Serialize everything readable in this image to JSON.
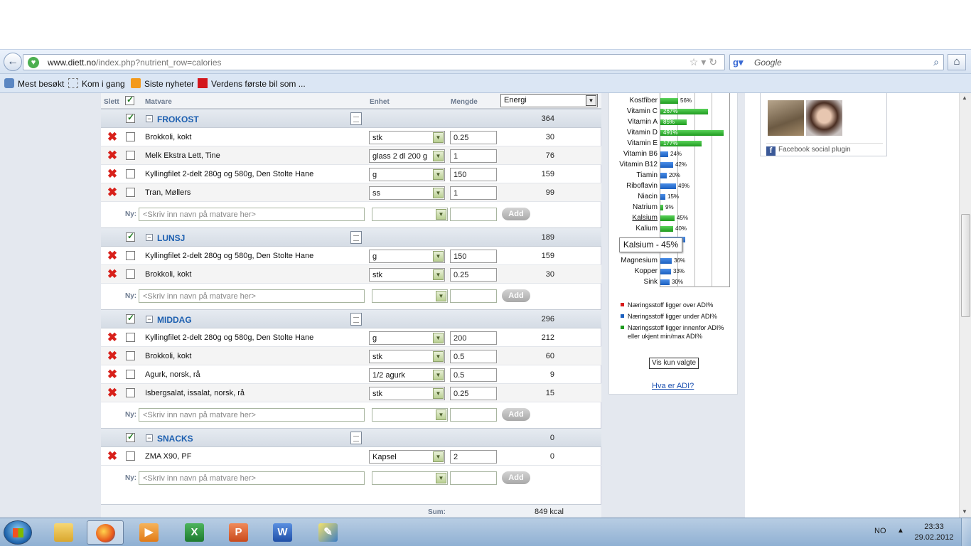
{
  "browser": {
    "url_domain": "www.diett.no",
    "url_path": "/index.php?nutrient_row=calories",
    "search_placeholder": "Google"
  },
  "bookmarks": [
    {
      "label": "Mest besøkt"
    },
    {
      "label": "Kom i gang"
    },
    {
      "label": "Siste nyheter"
    },
    {
      "label": "Verdens første bil som ..."
    }
  ],
  "columns": {
    "delete": "Slett",
    "food": "Matvare",
    "unit": "Enhet",
    "amount": "Mengde",
    "nutrient_select": "Energi"
  },
  "meals": [
    {
      "title": "FROKOST",
      "total": "364",
      "items": [
        {
          "name": "Brokkoli, kokt",
          "unit": "stk",
          "qty": "0.25",
          "value": "30"
        },
        {
          "name": "Melk Ekstra Lett, Tine",
          "unit": "glass 2 dl 200 g",
          "qty": "1",
          "value": "76"
        },
        {
          "name": "Kyllingfilet 2-delt 280g og 580g, Den Stolte Hane",
          "unit": "g",
          "qty": "150",
          "value": "159"
        },
        {
          "name": "Tran, Møllers",
          "unit": "ss",
          "qty": "1",
          "value": "99"
        }
      ]
    },
    {
      "title": "LUNSJ",
      "total": "189",
      "items": [
        {
          "name": "Kyllingfilet 2-delt 280g og 580g, Den Stolte Hane",
          "unit": "g",
          "qty": "150",
          "value": "159"
        },
        {
          "name": "Brokkoli, kokt",
          "unit": "stk",
          "qty": "0.25",
          "value": "30"
        }
      ]
    },
    {
      "title": "MIDDAG",
      "total": "296",
      "items": [
        {
          "name": "Kyllingfilet 2-delt 280g og 580g, Den Stolte Hane",
          "unit": "g",
          "qty": "200",
          "value": "212"
        },
        {
          "name": "Brokkoli, kokt",
          "unit": "stk",
          "qty": "0.5",
          "value": "60"
        },
        {
          "name": "Agurk, norsk, rå",
          "unit": "1/2 agurk",
          "qty": "0.5",
          "value": "9"
        },
        {
          "name": "Isbergsalat, issalat, norsk, rå",
          "unit": "stk",
          "qty": "0.25",
          "value": "15"
        }
      ]
    },
    {
      "title": "SNACKS",
      "total": "0",
      "items": [
        {
          "name": "ZMA X90, PF",
          "unit": "Kapsel",
          "qty": "2",
          "value": "0"
        }
      ]
    }
  ],
  "new_row": {
    "label": "Ny:",
    "placeholder": "<Skriv inn navn på matvare her>",
    "add_label": "Add"
  },
  "sum": {
    "label": "Sum:",
    "value": "849 kcal"
  },
  "nutrients": [
    {
      "name": "Kostfiber",
      "pct": 56,
      "label": "56%",
      "color": "green"
    },
    {
      "name": "Vitamin C",
      "pct": 267,
      "label": "267%",
      "color": "green"
    },
    {
      "name": "Vitamin A",
      "pct": 85,
      "label": "85%",
      "color": "green"
    },
    {
      "name": "Vitamin D",
      "pct": 491,
      "label": "491%",
      "color": "green"
    },
    {
      "name": "Vitamin E",
      "pct": 177,
      "label": "177%",
      "color": "green"
    },
    {
      "name": "Vitamin B6",
      "pct": 24,
      "label": "24%",
      "color": "blue"
    },
    {
      "name": "Vitamin B12",
      "pct": 42,
      "label": "42%",
      "color": "blue"
    },
    {
      "name": "Tiamin",
      "pct": 20,
      "label": "20%",
      "color": "blue"
    },
    {
      "name": "Riboflavin",
      "pct": 49,
      "label": "49%",
      "color": "blue"
    },
    {
      "name": "Niacin",
      "pct": 15,
      "label": "15%",
      "color": "blue"
    },
    {
      "name": "Natrium",
      "pct": 9,
      "label": "9%",
      "color": "green"
    },
    {
      "name": "Kalsium",
      "pct": 45,
      "label": "45%",
      "color": "green",
      "link": true
    },
    {
      "name": "Kalium",
      "pct": 40,
      "label": "40%",
      "color": "green"
    },
    {
      "name": "",
      "pct": 80,
      "label": "",
      "color": "blue"
    },
    {
      "name": "",
      "pct": 0,
      "label": "",
      "color": "blue"
    },
    {
      "name": "Magnesium",
      "pct": 36,
      "label": "36%",
      "color": "blue"
    },
    {
      "name": "Kopper",
      "pct": 33,
      "label": "33%",
      "color": "blue"
    },
    {
      "name": "Sink",
      "pct": 30,
      "label": "30%",
      "color": "blue"
    }
  ],
  "tooltip": "Kalsium - 45%",
  "legend": [
    {
      "color": "#d81b1b",
      "text": "Næringsstoff ligger over ADI%"
    },
    {
      "color": "#1b5fbf",
      "text": "Næringsstoff ligger under ADI%"
    },
    {
      "color": "#1f9a1f",
      "text": "Næringsstoff ligger innenfor ADI% eller ukjent min/max ADI%"
    }
  ],
  "vis_button": "Vis kun valgte",
  "adi_link": "Hva er ADI?",
  "facebook": {
    "footer": "Facebook social plugin"
  },
  "taskbar": {
    "lang": "NO",
    "time": "23:33",
    "date": "29.02.2012"
  }
}
